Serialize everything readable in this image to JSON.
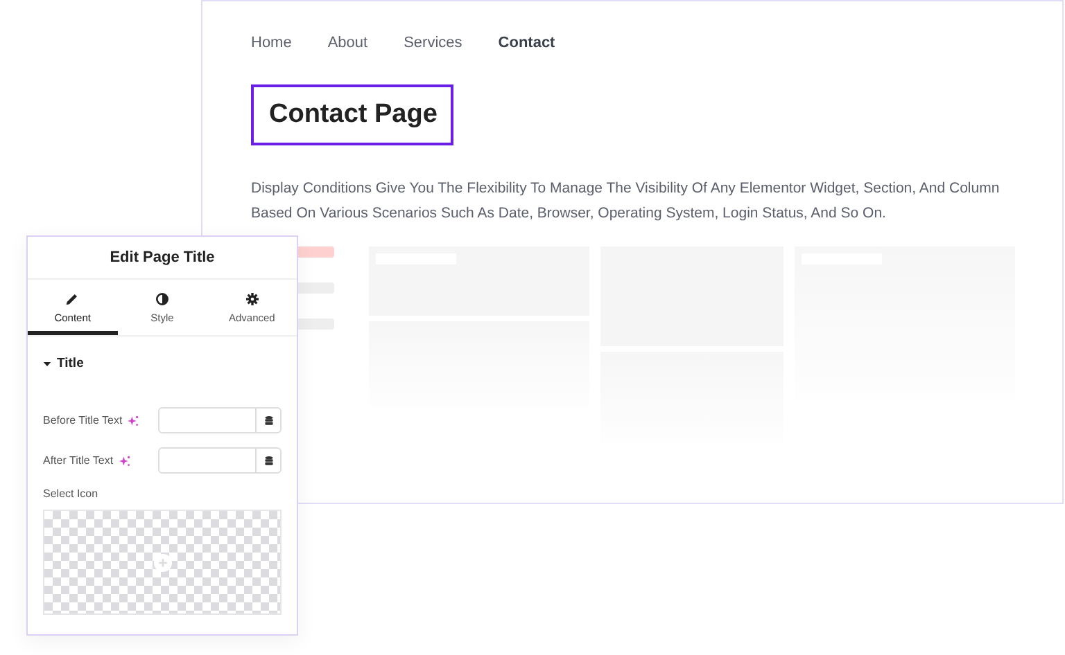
{
  "page": {
    "nav": [
      {
        "label": "Home",
        "selected": false
      },
      {
        "label": "About",
        "selected": false
      },
      {
        "label": "Services",
        "selected": false
      },
      {
        "label": "Contact",
        "selected": true
      }
    ],
    "heading": "Contact Page",
    "description": "Display Conditions Give You The Flexibility To Manage The Visibility Of Any Elementor Widget, Section, And Column Based On Various Scenarios Such As Date, Browser, Operating System, Login Status, And So On."
  },
  "panel": {
    "title": "Edit Page Title",
    "tabs": [
      {
        "label": "Content",
        "selected": true
      },
      {
        "label": "Style",
        "selected": false
      },
      {
        "label": "Advanced",
        "selected": false
      }
    ],
    "section": {
      "title": "Title",
      "expanded": true
    },
    "fields": [
      {
        "label": "Before Title Text"
      },
      {
        "label": "After Title Text"
      }
    ],
    "icon_picker": {
      "label": "Select Icon"
    }
  }
}
